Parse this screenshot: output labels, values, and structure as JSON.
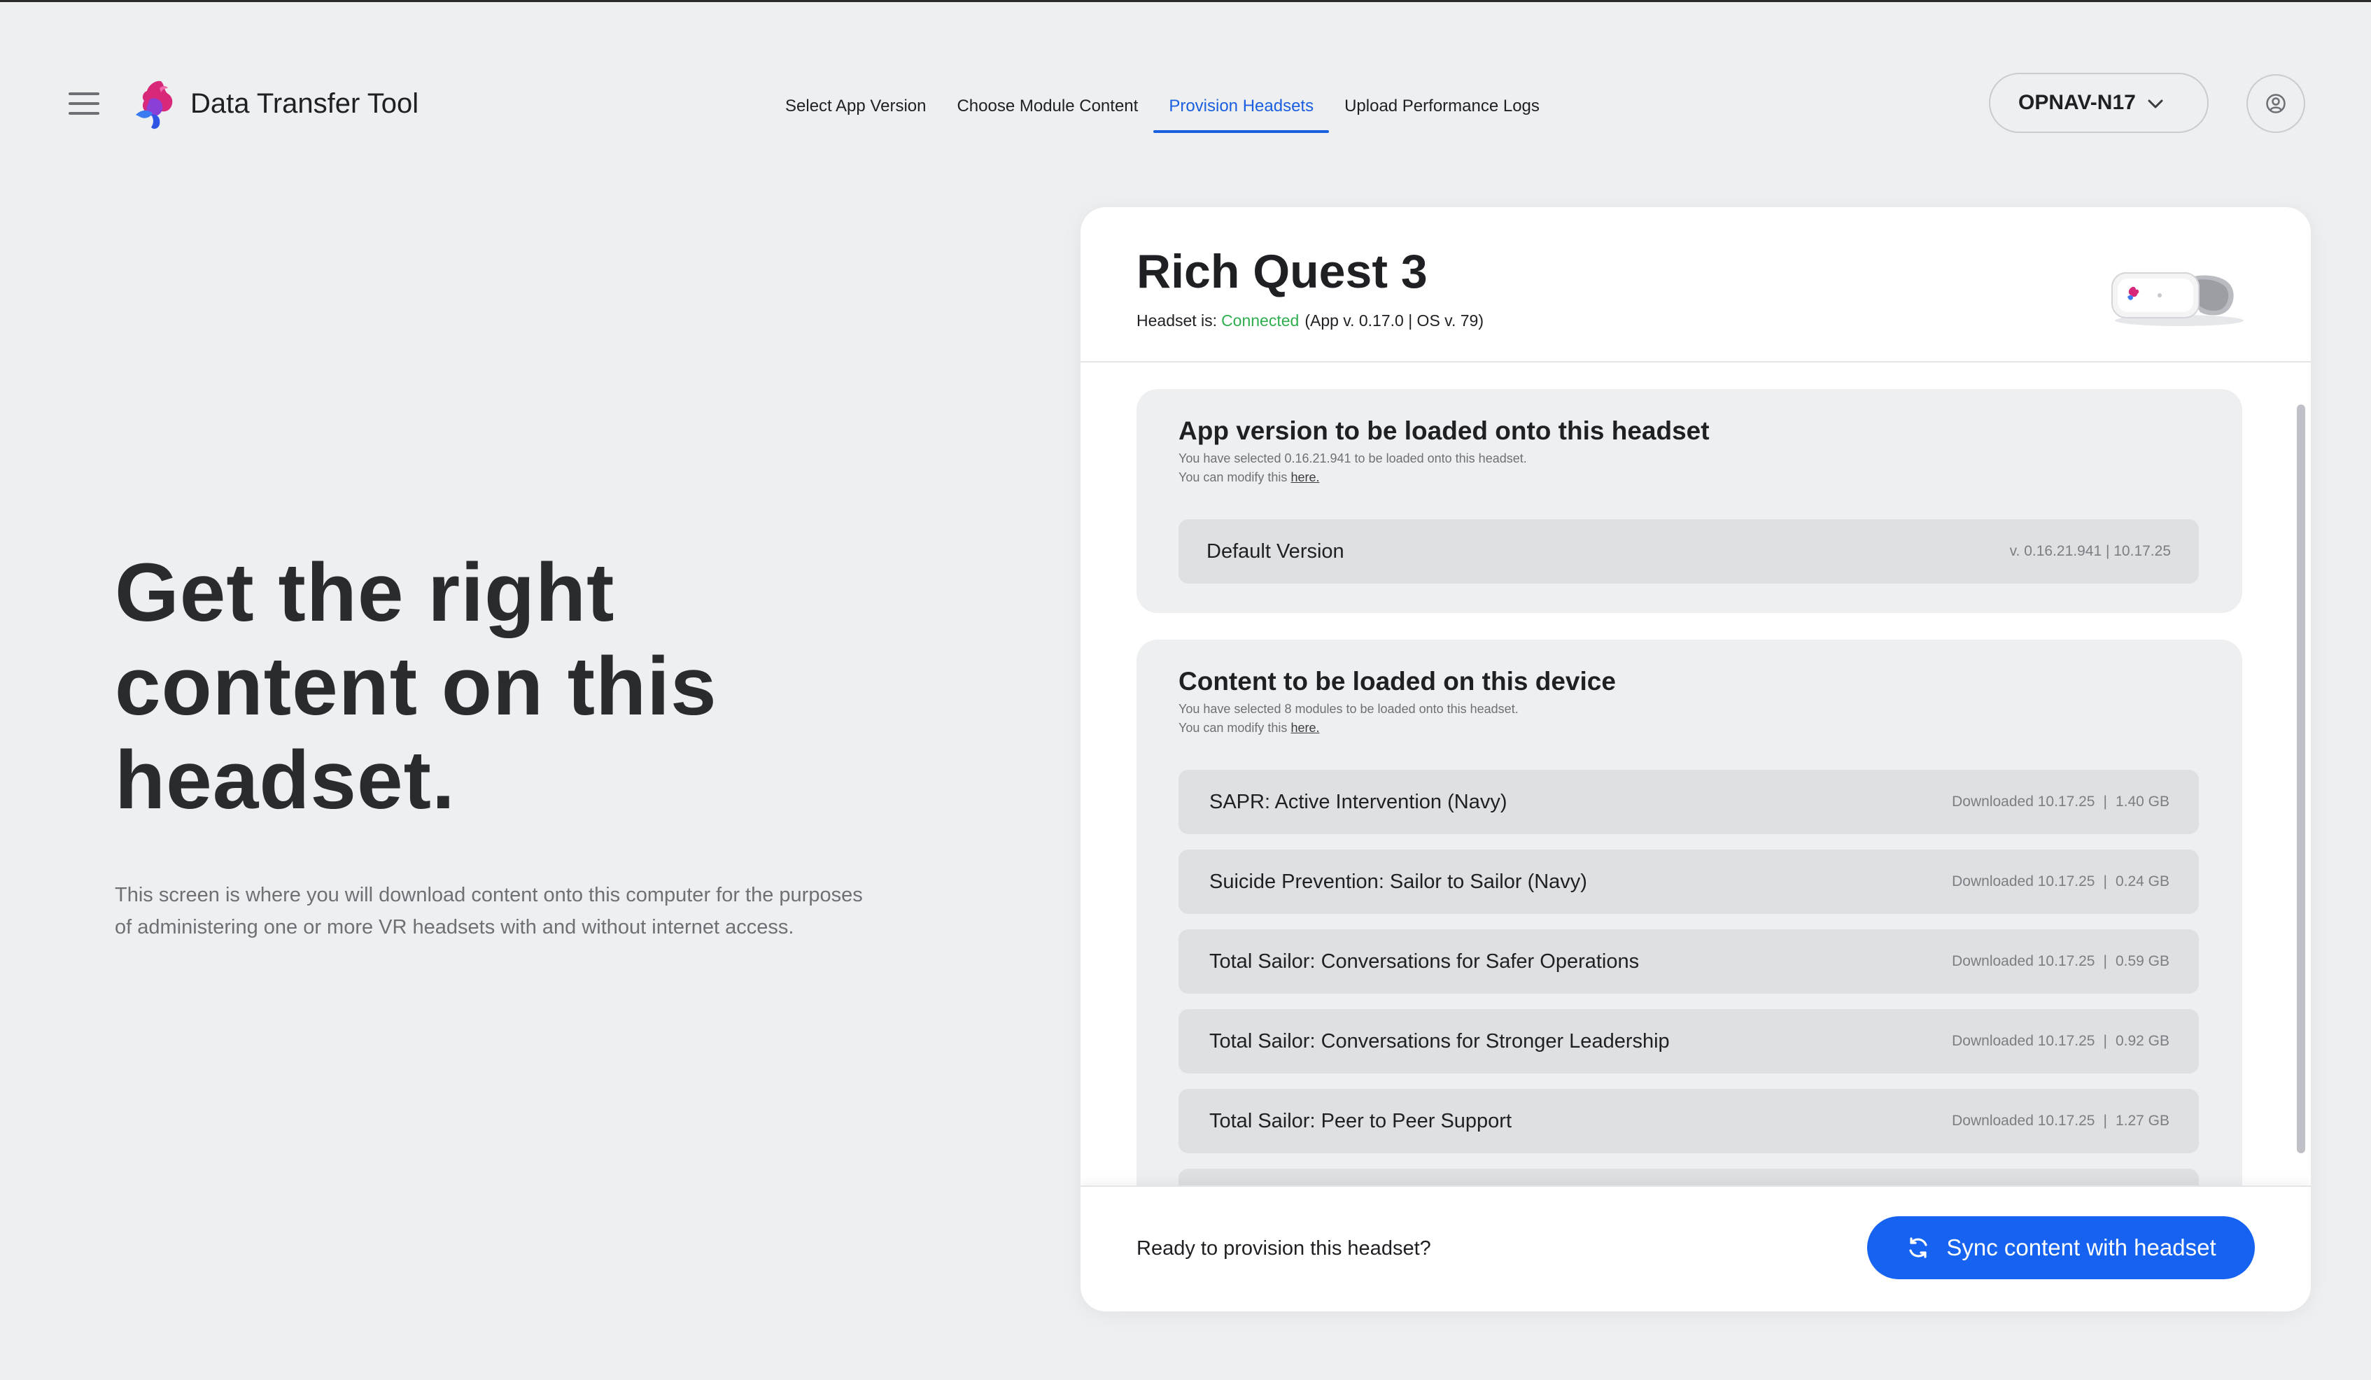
{
  "header": {
    "app_title": "Data Transfer Tool",
    "nav": [
      {
        "label": "Select App Version"
      },
      {
        "label": "Choose Module Content"
      },
      {
        "label": "Provision Headsets",
        "active": true
      },
      {
        "label": "Upload Performance Logs"
      }
    ],
    "org_selector": {
      "value": "OPNAV-N17"
    },
    "icons": {
      "menu": "hamburger-menu-icon",
      "logo": "app-logo-icon",
      "chevron": "chevron-down-icon",
      "profile": "user-profile-icon"
    }
  },
  "hero": {
    "title": "Get the right content on this headset.",
    "description": "This screen is where you will download content onto this computer for the purposes of administering one or more VR headsets with and without internet access."
  },
  "device": {
    "name": "Rich Quest 3",
    "status_prefix": "Headset is:",
    "status": "Connected",
    "status_detail": "(App v. 0.17.0 | OS v. 79)"
  },
  "app_version_section": {
    "title": "App version to be loaded onto this headset",
    "subtitle": "You have selected 0.16.21.941 to be loaded onto this headset.",
    "modify_prefix": "You can modify this",
    "modify_link": "here.",
    "selected": {
      "name": "Default Version",
      "meta": "v. 0.16.21.941 | 10.17.25"
    }
  },
  "content_section": {
    "title": "Content to be loaded on this device",
    "subtitle": "You have selected 8 modules to be loaded onto this headset.",
    "modify_prefix": "You can modify this",
    "modify_link": "here.",
    "modules": [
      {
        "name": "SAPR: Active Intervention (Navy)",
        "downloaded": "Downloaded 10.17.25",
        "size": "1.40 GB"
      },
      {
        "name": "Suicide Prevention: Sailor to Sailor (Navy)",
        "downloaded": "Downloaded 10.17.25",
        "size": "0.24 GB"
      },
      {
        "name": "Total Sailor: Conversations for Safer Operations",
        "downloaded": "Downloaded 10.17.25",
        "size": "0.59 GB"
      },
      {
        "name": "Total Sailor: Conversations for Stronger Leadership",
        "downloaded": "Downloaded 10.17.25",
        "size": "0.92 GB"
      },
      {
        "name": "Total Sailor: Peer to Peer Support",
        "downloaded": "Downloaded 10.17.25",
        "size": "1.27 GB"
      },
      {
        "name": "",
        "downloaded": "",
        "size": ""
      }
    ]
  },
  "footer": {
    "prompt": "Ready to provision this headset?",
    "sync_button": "Sync content with headset",
    "sync_icon": "sync-icon"
  },
  "colors": {
    "accent": "#1663f2",
    "connected": "#2eae4f",
    "background": "#eeeff1"
  }
}
